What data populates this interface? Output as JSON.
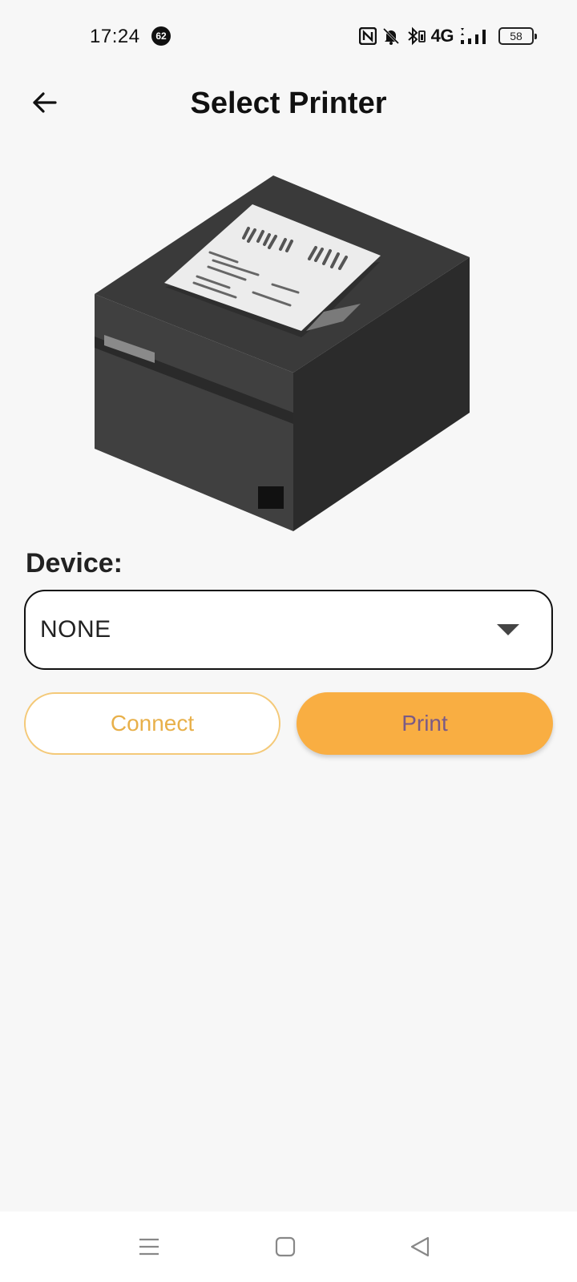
{
  "status_bar": {
    "time": "17:24",
    "notification_count": "62",
    "network": "4G",
    "battery_level": "58",
    "battery_fraction": 0.58,
    "icons": [
      "nfc-icon",
      "mute-bell-icon",
      "bluetooth-icon",
      "signal-icon"
    ]
  },
  "app_bar": {
    "title": "Select Printer",
    "back_icon": "back-arrow-icon"
  },
  "device": {
    "label": "Device:",
    "selected_value": "NONE",
    "dropdown_icon": "dropdown-arrow-icon"
  },
  "actions": {
    "connect_label": "Connect",
    "print_label": "Print"
  },
  "colors": {
    "accent": "#f9ae42",
    "connect_text": "#e8b04a",
    "print_text": "#7a5a86",
    "background": "#f7f7f7"
  },
  "nav_bar": {
    "icons": [
      "recents-icon",
      "home-icon",
      "back-icon"
    ]
  }
}
